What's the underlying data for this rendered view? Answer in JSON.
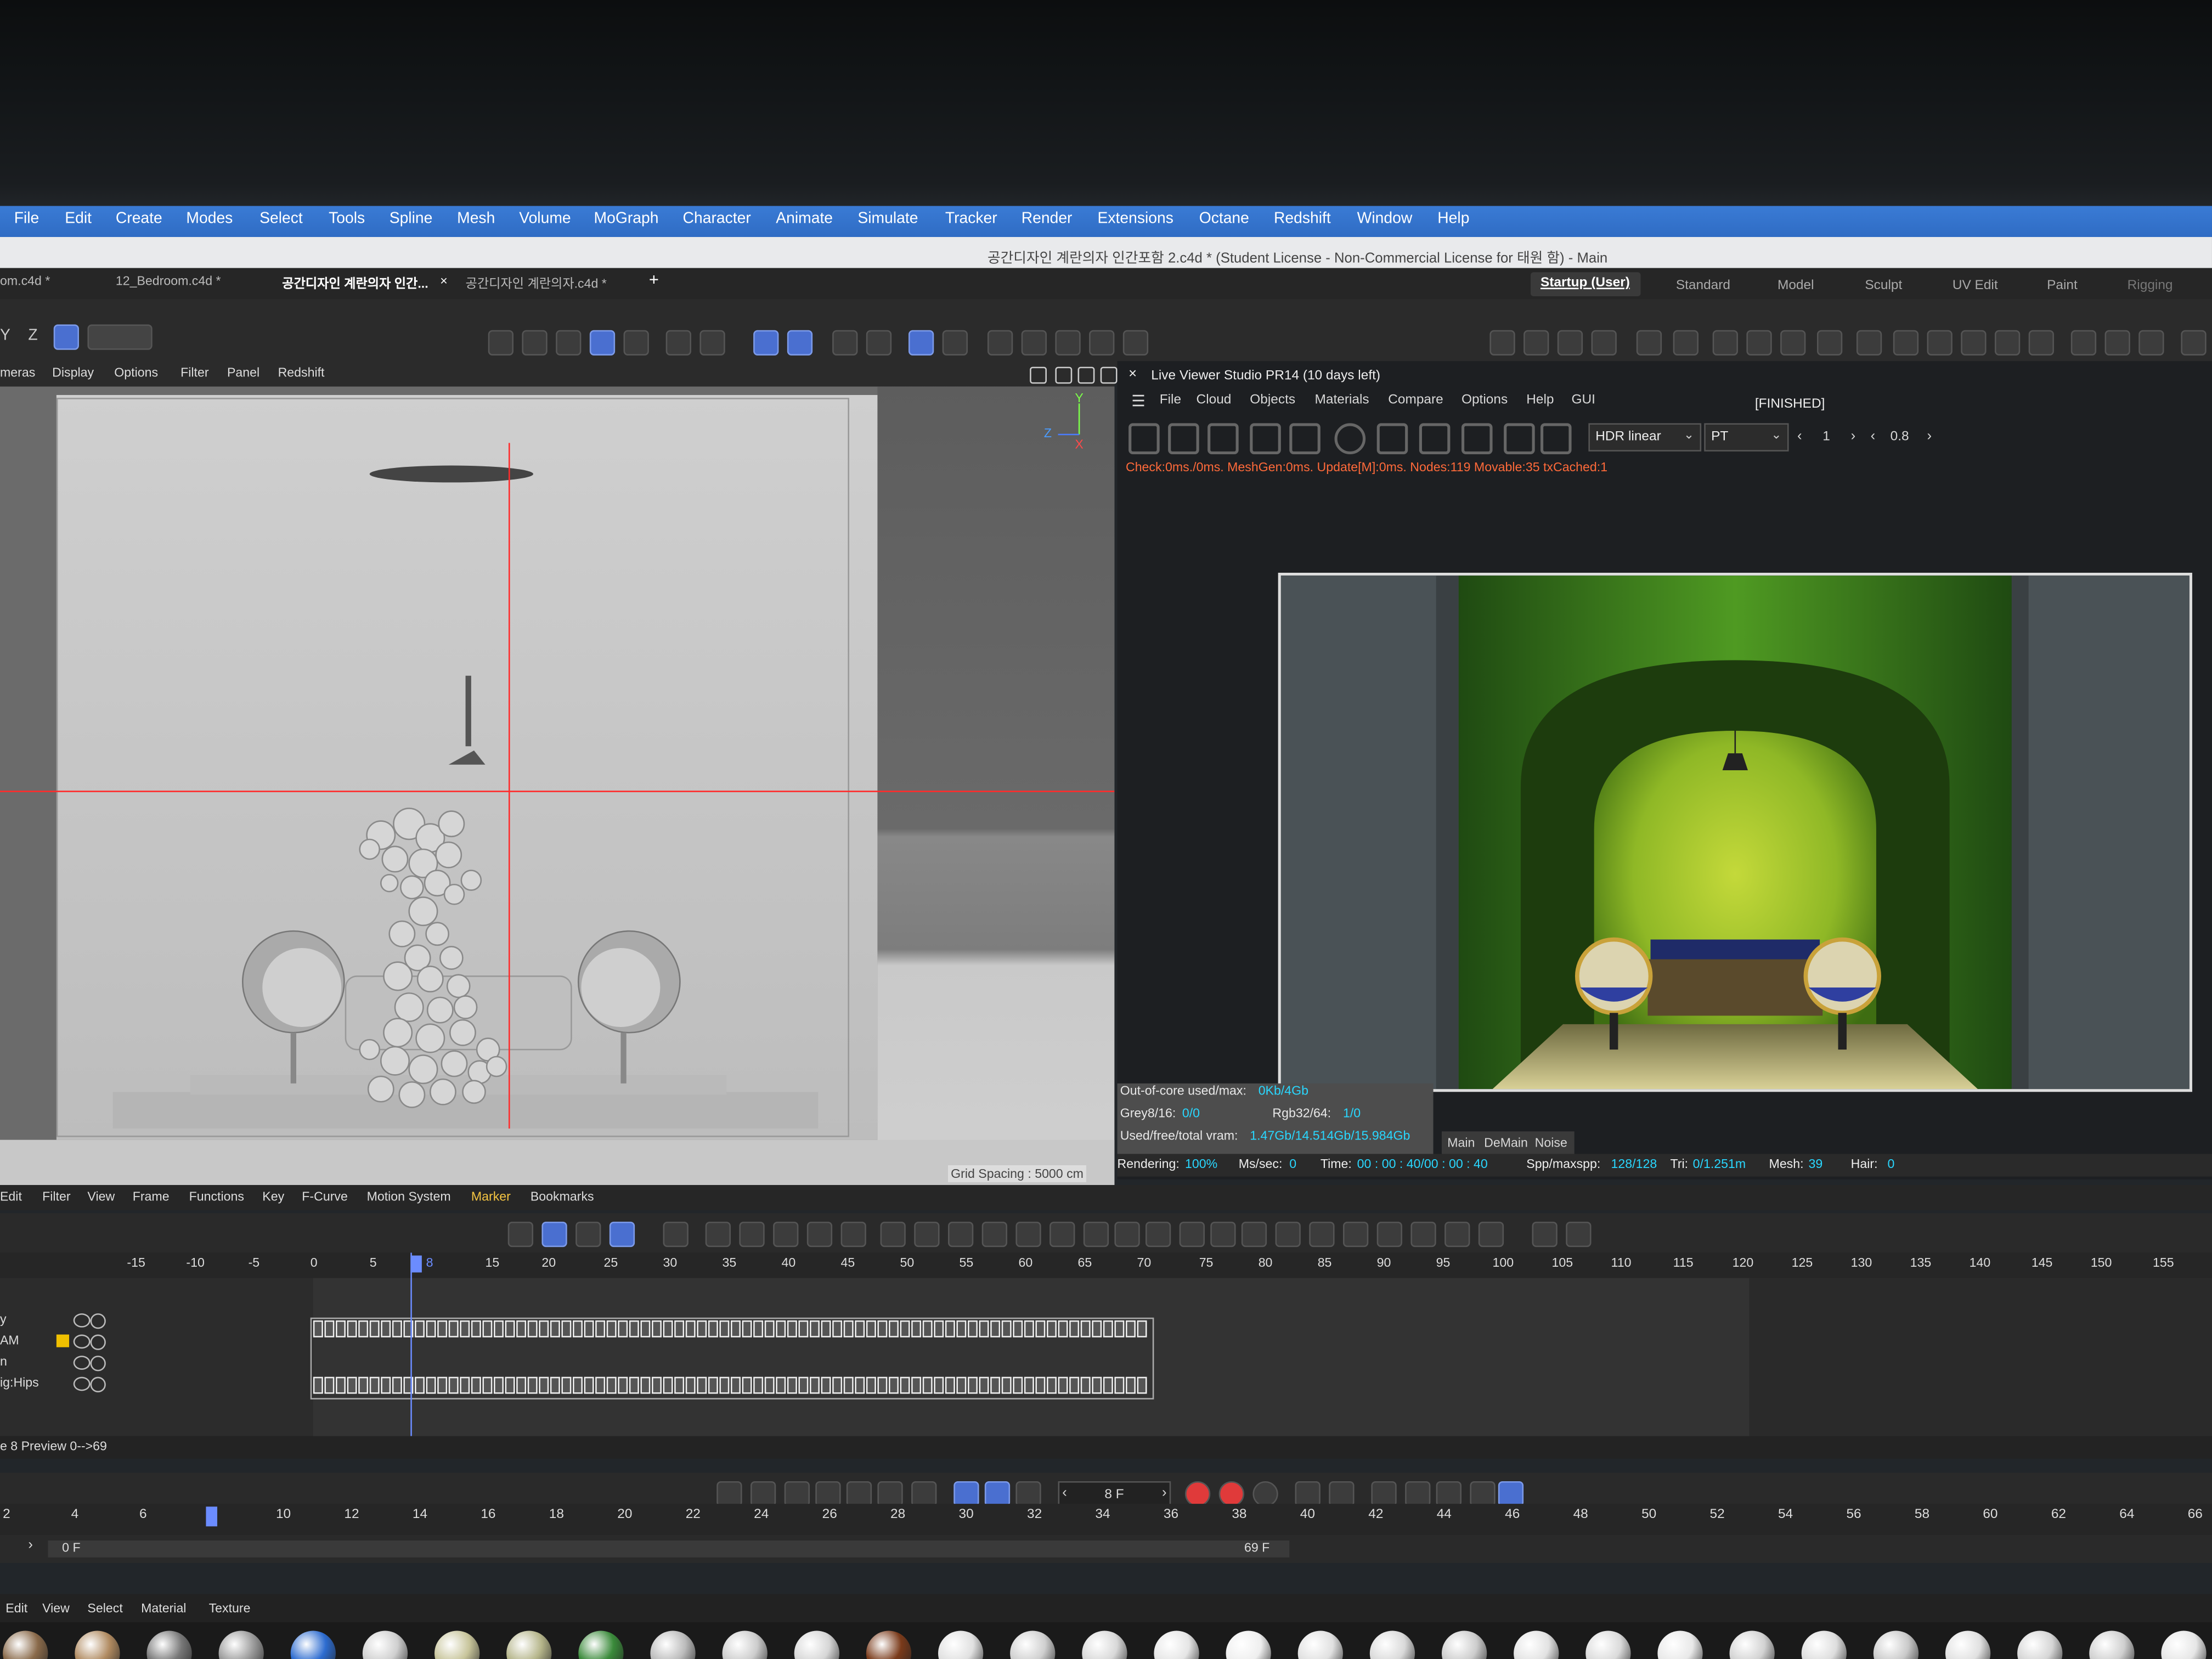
{
  "menubar": [
    "File",
    "Edit",
    "Create",
    "Modes",
    "Select",
    "Tools",
    "Spline",
    "Mesh",
    "Volume",
    "MoGraph",
    "Character",
    "Animate",
    "Simulate",
    "Tracker",
    "Render",
    "Extensions",
    "Octane",
    "Redshift",
    "Window",
    "Help"
  ],
  "window_title": "공간디자인 계란의자 인간포함 2.c4d * (Student License - Non-Commercial License for 태원 함) - Main",
  "tabs": [
    "om.c4d *",
    "12_Bedroom.c4d *",
    "공간디자인 계란의자 인간...",
    "공간디자인 계란의자.c4d *"
  ],
  "tab_close": "×",
  "tab_add": "+",
  "layouts": [
    "Startup (User)",
    "Standard",
    "Model",
    "Sculpt",
    "UV Edit",
    "Paint",
    "Rigging"
  ],
  "axis_labels": [
    "Y",
    "Z"
  ],
  "viewport_menu": [
    "meras",
    "Display",
    "Options",
    "Filter",
    "Panel",
    "Redshift"
  ],
  "gizmo": {
    "y": "Y",
    "z": "Z",
    "x": "X"
  },
  "grid_spacing": "Grid Spacing : 5000 cm",
  "live_viewer": {
    "title": "Live Viewer Studio PR14 (10 days left)",
    "close": "×",
    "menu": [
      "File",
      "Cloud",
      "Objects",
      "Materials",
      "Compare",
      "Options",
      "Help",
      "GUI"
    ],
    "status": "[FINISHED]",
    "tonemap": "HDR linear",
    "kernel": "PT",
    "value1": "1",
    "value2": "0.8",
    "status_line": "Check:0ms./0ms. MeshGen:0ms. Update[M]:0ms. Nodes:119 Movable:35 txCached:1"
  },
  "stats": {
    "core_label": "Out-of-core used/max:",
    "core_value": "0Kb/4Gb",
    "grey_label": "Grey8/16:",
    "grey_value": "0/0",
    "rgb_label": "Rgb32/64:",
    "rgb_value": "1/0",
    "vram_label": "Used/free/total vram:",
    "vram_value": "1.47Gb/14.514Gb/15.984Gb",
    "tabs": [
      "Main",
      "DeMain",
      "Noise"
    ],
    "rendering_label": "Rendering:",
    "rendering_value": "100%",
    "ms_label": "Ms/sec:",
    "ms_value": "0",
    "time_label": "Time:",
    "time_value": "00 : 00 : 40/00 : 00 : 40",
    "spp_label": "Spp/maxspp:",
    "spp_value": "128/128",
    "tri_label": "Tri:",
    "tri_value": "0/1.251m",
    "mesh_label": "Mesh:",
    "mesh_value": "39",
    "hair_label": "Hair:",
    "hair_value": "0"
  },
  "timeline_menu": [
    "Edit",
    "Filter",
    "View",
    "Frame",
    "Functions",
    "Key",
    "F-Curve",
    "Motion System",
    "Marker",
    "Bookmarks"
  ],
  "timeline_ruler": [
    "-15",
    "-10",
    "-5",
    "0",
    "5",
    "8",
    "15",
    "20",
    "25",
    "30",
    "35",
    "40",
    "45",
    "50",
    "55",
    "60",
    "65",
    "70",
    "75",
    "80",
    "85",
    "90",
    "95",
    "100",
    "105",
    "110",
    "115",
    "120",
    "125",
    "130",
    "135",
    "140",
    "145",
    "150",
    "155"
  ],
  "tracks": [
    "y",
    "AM",
    "n",
    "ig:Hips"
  ],
  "timeline_info": "e 8 Preview 0-->69",
  "current_frame": "8 F",
  "playback_ruler": [
    "2",
    "4",
    "6",
    "8",
    "10",
    "12",
    "14",
    "16",
    "18",
    "20",
    "22",
    "24",
    "26",
    "28",
    "30",
    "32",
    "34",
    "36",
    "38",
    "40",
    "42",
    "44",
    "46",
    "48",
    "50",
    "52",
    "54",
    "56",
    "58",
    "60",
    "62",
    "64",
    "66"
  ],
  "range_start": "0 F",
  "range_end": "69 F",
  "material_menu": [
    "Edit",
    "View",
    "Select",
    "Material",
    "Texture"
  ],
  "colors": {
    "menubar": "#2f6cc4",
    "accent": "#4a6fd0",
    "status_orange": "#ff6a3a",
    "stat_cyan": "#29d7ff",
    "green_wall": "#3c8a1c",
    "lamp_green": "#b8d22a"
  }
}
